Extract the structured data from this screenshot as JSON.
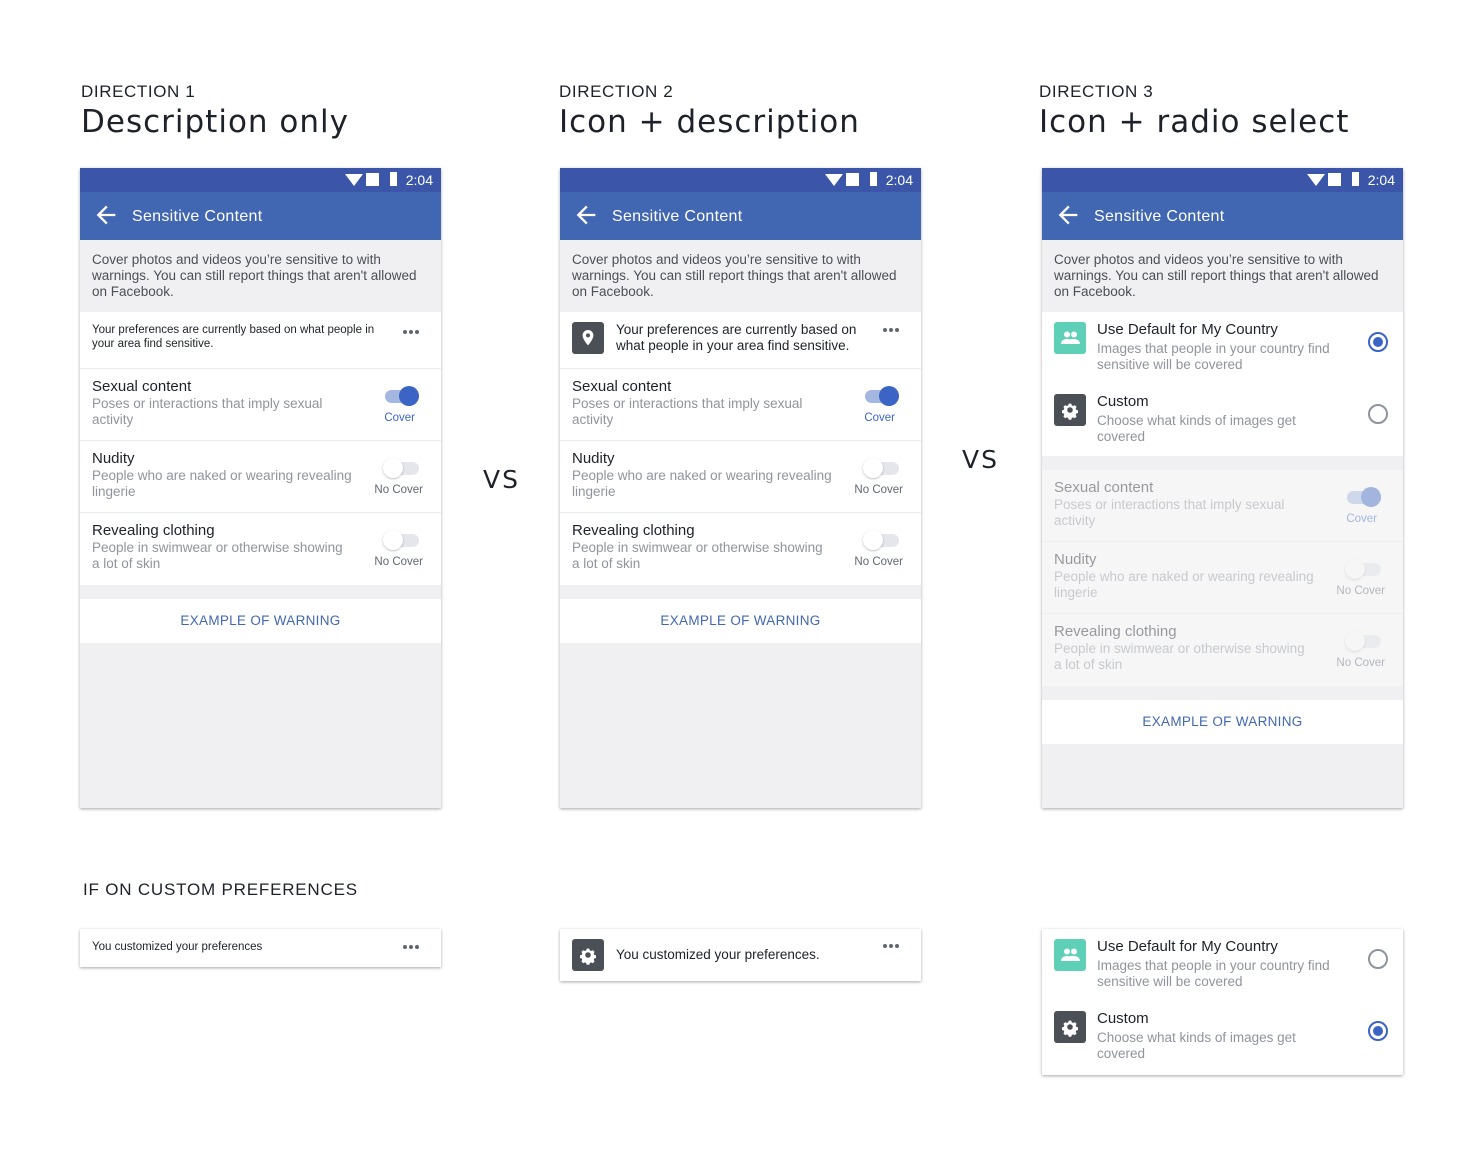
{
  "directions": [
    {
      "label": "DIRECTION 1",
      "title": "Description only"
    },
    {
      "label": "DIRECTION 2",
      "title": "Icon + description"
    },
    {
      "label": "DIRECTION 3",
      "title": "Icon + radio select"
    }
  ],
  "vs_label": "VS",
  "custom_section_label": "IF ON CUSTOM PREFERENCES",
  "status_bar": {
    "time": "2:04"
  },
  "app_bar": {
    "title": "Sensitive Content"
  },
  "intro_text": "Cover photos and videos you’re sensitive to with warnings. You can still report things that aren't allowed on Facebook.",
  "preferences_banner": "Your preferences are currently based on what people in your area find sensitive.",
  "preferences_banner_d1": "Your preferences are currently based on what people in your area find sensitive.",
  "categories": [
    {
      "title": "Sexual content",
      "description": "Poses or interactions that imply sexual activity",
      "state": "Cover"
    },
    {
      "title": "Nudity",
      "description": "People who are naked or wearing revealing lingerie",
      "state": "No Cover"
    },
    {
      "title": "Revealing clothing",
      "description": "People in swimwear or otherwise showing a lot of skin",
      "state": "No Cover"
    }
  ],
  "example_button": "EXAMPLE OF WARNING",
  "radio_options": [
    {
      "title": "Use Default for My Country",
      "description": "Images that people in your country find sensitive will be covered",
      "icon": "people-icon"
    },
    {
      "title": "Custom",
      "description": "Choose what kinds of images get covered",
      "icon": "gear-icon"
    }
  ],
  "custom_banner_d1": "You customized your preferences",
  "custom_banner_d2": "You customized your preferences.",
  "colors": {
    "status_bar": "#3b56a8",
    "app_bar": "#4267b2",
    "accent": "#3b64c4",
    "icon_green": "#5fd0b8"
  }
}
